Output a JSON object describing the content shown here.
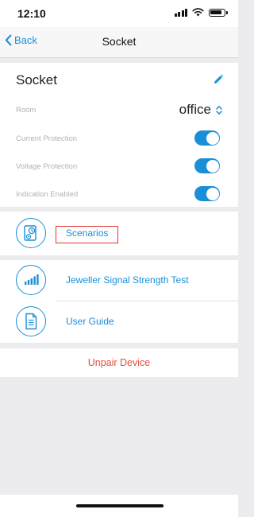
{
  "status_bar": {
    "time": "12:10",
    "battery_level": 0.85
  },
  "nav": {
    "back_label": "Back",
    "title": "Socket"
  },
  "device": {
    "name": "Socket",
    "room_label": "Room",
    "room_value": "office",
    "settings": [
      {
        "label": "Current Protection",
        "enabled": true
      },
      {
        "label": "Voltage Protection",
        "enabled": true
      },
      {
        "label": "Indication Enabled",
        "enabled": true
      }
    ]
  },
  "scenarios": {
    "label": "Scenarios"
  },
  "links": [
    {
      "label": "Jeweller Signal Strength Test",
      "icon": "signal-bars-icon"
    },
    {
      "label": "User Guide",
      "icon": "document-icon"
    }
  ],
  "unpair": {
    "label": "Unpair Device"
  },
  "colors": {
    "accent": "#1a8fd8",
    "danger": "#e74c3c",
    "highlight": "#e0332f"
  }
}
